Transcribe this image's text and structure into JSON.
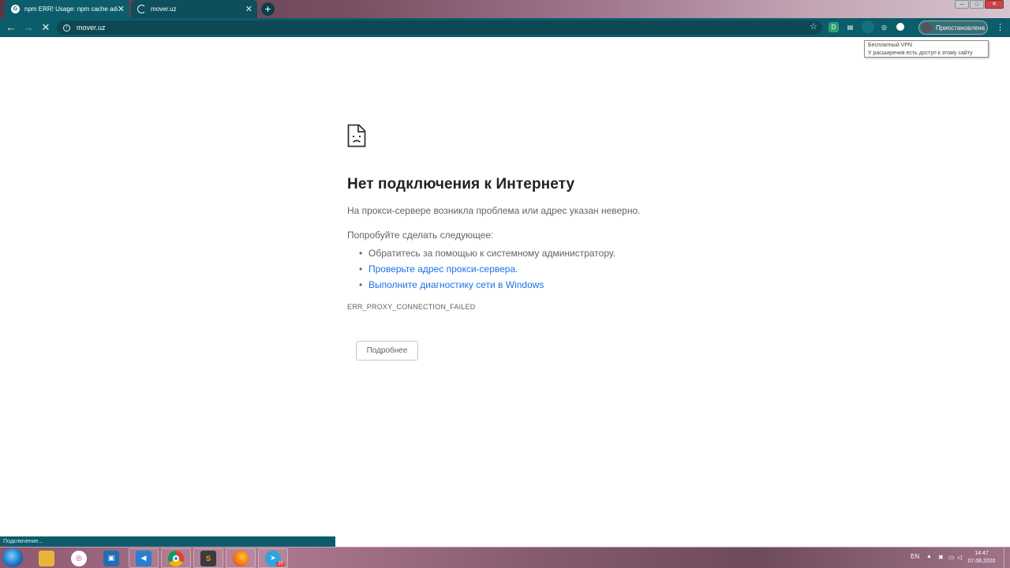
{
  "browser": {
    "tabs": [
      {
        "title": "npm ERR! Usage: npm cache add",
        "state": "inactive",
        "favicon": "google-icon"
      },
      {
        "title": "mover.uz",
        "state": "active",
        "favicon": "loading-spinner-icon"
      }
    ],
    "new_tab_symbol": "+",
    "url": "mover.uz",
    "profile_label": "Приостановлена"
  },
  "tooltip": {
    "title": "Бесплатный VPN",
    "text": "У расширения есть доступ к этому сайту"
  },
  "error": {
    "heading": "Нет подключения к Интернету",
    "description": "На прокси-сервере возникла проблема или адрес указан неверно.",
    "try_label": "Попробуйте сделать следующее:",
    "suggestions": [
      {
        "text": "Обратитесь за помощью к системному администратору.",
        "link": false
      },
      {
        "text": "Проверьте адрес прокси-сервера.",
        "link": true
      },
      {
        "text": "Выполните диагностику сети в Windows",
        "link": true
      }
    ],
    "code": "ERR_PROXY_CONNECTION_FAILED",
    "details_button": "Подробнее"
  },
  "status_bar": "Подключение...",
  "taskbar": {
    "apps": [
      "file-explorer-icon",
      "instagram-icon",
      "virtualbox-icon",
      "vscode-icon",
      "chrome-icon",
      "sublime-text-icon",
      "firefox-icon",
      "telegram-icon"
    ],
    "telegram_badge": "20",
    "language": "EN",
    "time": "14:47",
    "date": "07.06.2020"
  },
  "colors": {
    "chrome_teal": "#0b5d6b",
    "link_blue": "#1a73e8",
    "text_gray": "#5f6368",
    "heading": "#202124"
  }
}
